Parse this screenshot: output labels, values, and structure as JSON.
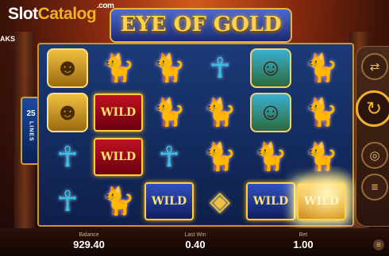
{
  "brand": {
    "slot": "Slot",
    "catalog": "Catalog",
    "com": ".com"
  },
  "aks_text": "AKS",
  "game_title": "EYE OF GOLD",
  "lines": {
    "count": "25",
    "label": "LINES"
  },
  "reels": [
    [
      {
        "symbol": "pharaoh"
      },
      {
        "symbol": "pharaoh"
      },
      {
        "symbol": "ankh"
      },
      {
        "symbol": "ankh"
      }
    ],
    [
      {
        "symbol": "cat"
      },
      {
        "symbol": "wild",
        "label": "WILD"
      },
      {
        "symbol": "wild",
        "label": "WILD"
      },
      {
        "symbol": "cat"
      }
    ],
    [
      {
        "symbol": "cat"
      },
      {
        "symbol": "cat"
      },
      {
        "symbol": "ankh"
      },
      {
        "symbol": "wild",
        "label": "WILD"
      }
    ],
    [
      {
        "symbol": "ankh"
      },
      {
        "symbol": "cat"
      },
      {
        "symbol": "cat"
      },
      {
        "symbol": "horus"
      }
    ],
    [
      {
        "symbol": "queen"
      },
      {
        "symbol": "queen"
      },
      {
        "symbol": "cat"
      },
      {
        "symbol": "wild",
        "label": "WILD"
      }
    ],
    [
      {
        "symbol": "cat"
      },
      {
        "symbol": "cat"
      },
      {
        "symbol": "cat"
      },
      {
        "symbol": "wild",
        "label": "WILD"
      }
    ]
  ],
  "side_panel": {
    "autoplay_icon": "arrows-icon",
    "spin_icon": "spin-icon",
    "bet_icon": "coins-icon"
  },
  "stats": {
    "balance_label": "Balance",
    "balance_value": "929.40",
    "lastwin_label": "Last Win",
    "lastwin_value": "0.40",
    "bet_label": "Bet",
    "bet_value": "1.00"
  },
  "colors": {
    "gold": "#f0b020",
    "frame": "#c9962c",
    "wild_red": "#c01020"
  }
}
